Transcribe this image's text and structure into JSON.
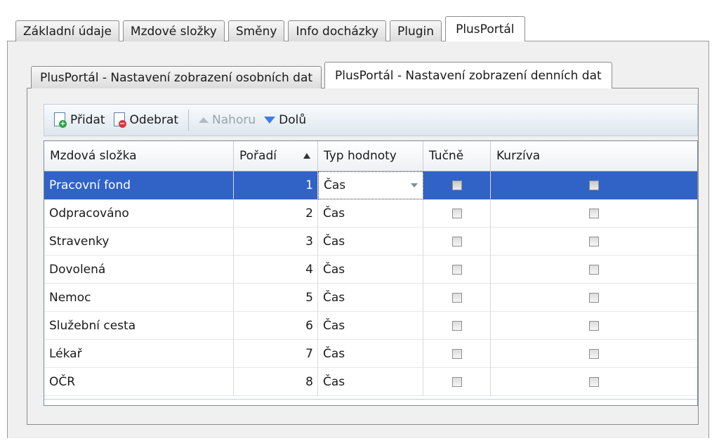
{
  "outer_tabs": [
    "Základní údaje",
    "Mzdové složky",
    "Směny",
    "Info docházky",
    "Plugin",
    "PlusPortál"
  ],
  "outer_active": "PlusPortál",
  "inner_tabs": [
    "PlusPortál - Nastavení zobrazení osobních dat",
    "PlusPortál - Nastavení zobrazení denních dat"
  ],
  "inner_active": "PlusPortál - Nastavení zobrazení denních dat",
  "toolbar": {
    "add_label": "Přidat",
    "remove_label": "Odebrat",
    "up_label": "Nahoru",
    "down_label": "Dolů"
  },
  "grid": {
    "columns": [
      "Mzdová složka",
      "Pořadí",
      "Typ hodnoty",
      "Tučně",
      "Kurzíva"
    ],
    "rows": [
      {
        "name": "Pracovní fond",
        "order": "1",
        "type": "Čas",
        "bold": false,
        "italic": false,
        "selected": true
      },
      {
        "name": "Odpracováno",
        "order": "2",
        "type": "Čas",
        "bold": false,
        "italic": false
      },
      {
        "name": "Stravenky",
        "order": "3",
        "type": "Čas",
        "bold": false,
        "italic": false
      },
      {
        "name": "Dovolená",
        "order": "4",
        "type": "Čas",
        "bold": false,
        "italic": false
      },
      {
        "name": "Nemoc",
        "order": "5",
        "type": "Čas",
        "bold": false,
        "italic": false
      },
      {
        "name": "Služební cesta",
        "order": "6",
        "type": "Čas",
        "bold": false,
        "italic": false
      },
      {
        "name": "Lékař",
        "order": "7",
        "type": "Čas",
        "bold": false,
        "italic": false
      },
      {
        "name": "OČR",
        "order": "8",
        "type": "Čas",
        "bold": false,
        "italic": false
      }
    ]
  },
  "colors": {
    "selection": "#3163c6",
    "add_badge": "#2ea043",
    "remove_badge": "#d9363e"
  }
}
